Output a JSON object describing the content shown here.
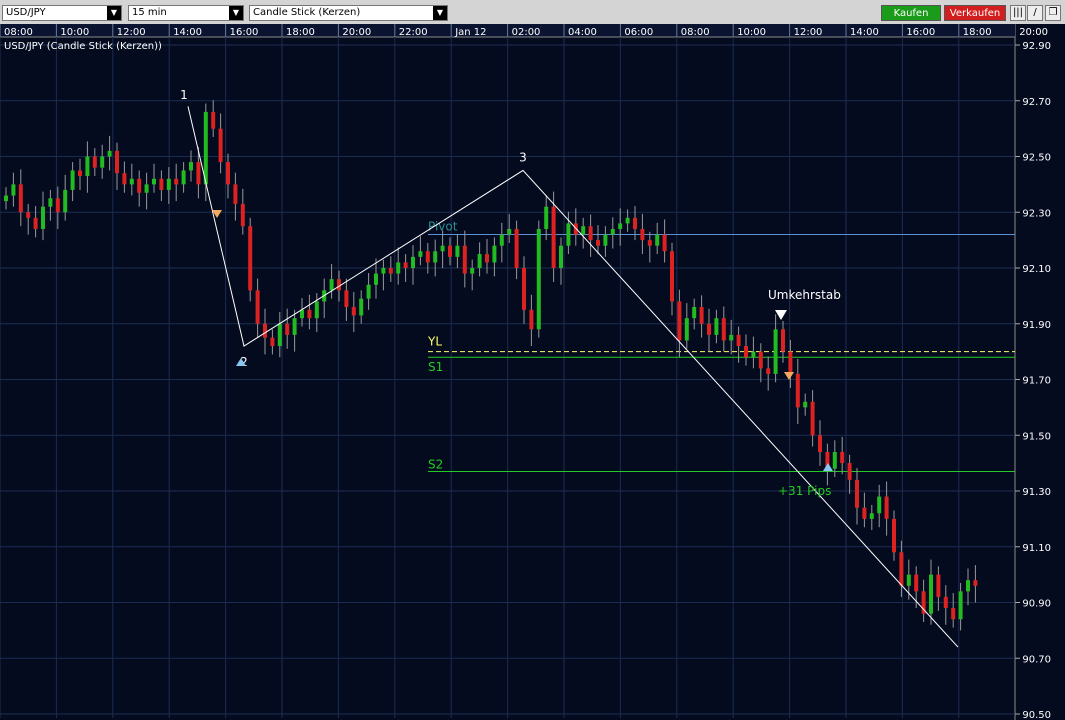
{
  "toolbar": {
    "symbol": "USD/JPY",
    "timeframe": "15 min",
    "chart_style": "Candle Stick (Kerzen)",
    "buy_label": "Kaufen",
    "sell_label": "Verkaufen"
  },
  "colors": {
    "background": "#050b1f",
    "grid": "#1a2c50",
    "bull": "#22bb22",
    "bear": "#dd2222",
    "pivot": "#5b8fd6",
    "s_level": "#22cc22",
    "yl": "#ffff66",
    "buy_button": "#1a9c1a",
    "sell_button": "#d21e1e"
  },
  "chart_data": {
    "type": "candlestick",
    "title": "USD/JPY (Candle Stick (Kerzen))",
    "x_ticks": [
      "08:00",
      "10:00",
      "12:00",
      "14:00",
      "16:00",
      "18:00",
      "20:00",
      "22:00",
      "Jan 12",
      "02:00",
      "04:00",
      "06:00",
      "08:00",
      "10:00",
      "12:00",
      "14:00",
      "16:00",
      "18:00",
      "20:00"
    ],
    "y_ticks": [
      "92.90",
      "92.70",
      "92.50",
      "92.30",
      "92.10",
      "91.90",
      "91.70",
      "91.50",
      "91.30",
      "91.10",
      "90.90",
      "90.70",
      "90.50"
    ],
    "ylim": [
      90.5,
      92.9
    ],
    "grid": true,
    "levels": [
      {
        "label": "Pivot",
        "value": 92.22
      },
      {
        "label": "YL",
        "value": 91.8
      },
      {
        "label": "S1",
        "value": 91.78
      },
      {
        "label": "S2",
        "value": 91.37
      }
    ],
    "pattern_points": [
      {
        "label": "1",
        "value": 92.68
      },
      {
        "label": "2",
        "value": 91.82
      },
      {
        "label": "3",
        "value": 92.45
      }
    ],
    "annotations": [
      "Umkehrstab",
      "+31 Pips"
    ],
    "candles_close": [
      92.36,
      92.4,
      92.3,
      92.28,
      92.24,
      92.32,
      92.35,
      92.3,
      92.38,
      92.45,
      92.43,
      92.5,
      92.46,
      92.5,
      92.52,
      92.44,
      92.4,
      92.42,
      92.37,
      92.4,
      92.42,
      92.38,
      92.42,
      92.4,
      92.45,
      92.48,
      92.4,
      92.66,
      92.6,
      92.48,
      92.4,
      92.33,
      92.25,
      92.02,
      91.9,
      91.85,
      91.82,
      91.9,
      91.86,
      91.92,
      91.95,
      91.92,
      91.98,
      92.02,
      92.06,
      92.02,
      91.96,
      91.93,
      91.99,
      92.04,
      92.08,
      92.1,
      92.08,
      92.12,
      92.1,
      92.14,
      92.16,
      92.12,
      92.16,
      92.18,
      92.14,
      92.18,
      92.08,
      92.1,
      92.15,
      92.12,
      92.18,
      92.22,
      92.24,
      92.1,
      91.95,
      91.88,
      92.24,
      92.32,
      92.1,
      92.18,
      92.26,
      92.22,
      92.25,
      92.2,
      92.18,
      92.22,
      92.24,
      92.26,
      92.28,
      92.24,
      92.2,
      92.18,
      92.22,
      92.16,
      91.98,
      91.84,
      91.92,
      91.96,
      91.9,
      91.86,
      91.92,
      91.84,
      91.86,
      91.82,
      91.78,
      91.8,
      91.74,
      91.72,
      91.88,
      91.8,
      91.72,
      91.6,
      91.62,
      91.5,
      91.44,
      91.38,
      91.44,
      91.4,
      91.34,
      91.24,
      91.2,
      91.22,
      91.28,
      91.2,
      91.08,
      90.96,
      91.0,
      90.94,
      90.86,
      91.0,
      90.92,
      90.88,
      90.84,
      90.94,
      90.98,
      90.96
    ]
  }
}
